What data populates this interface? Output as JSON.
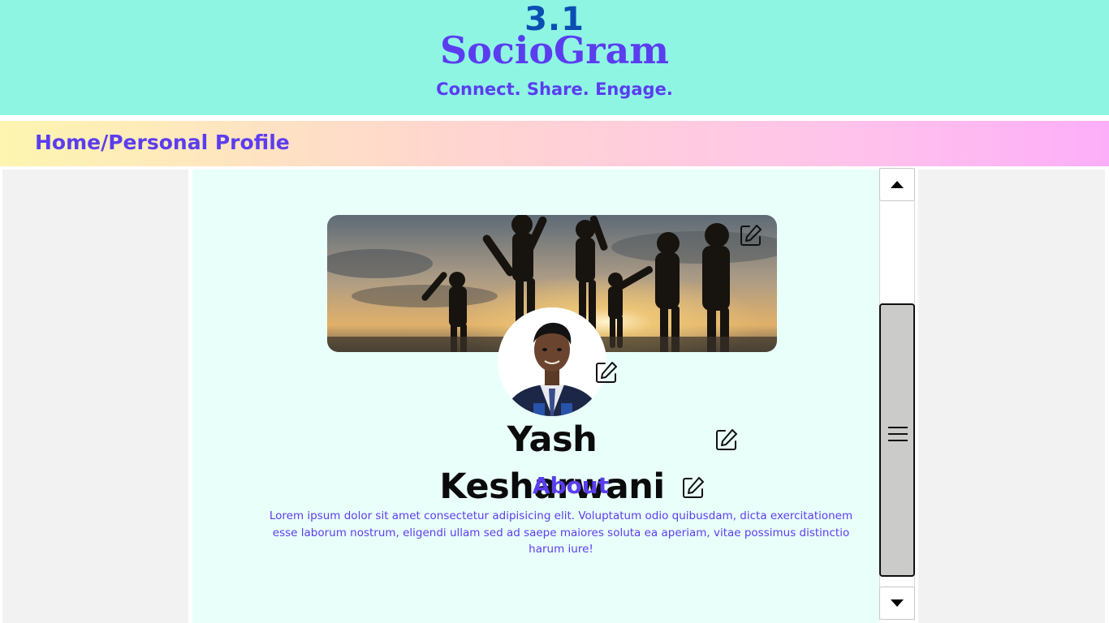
{
  "header": {
    "version": "3.1",
    "brand": "SocioGram",
    "tagline": "Connect. Share. Engage."
  },
  "breadcrumb": "Home/Personal Profile",
  "profile": {
    "name": "Yash Kesharwani",
    "about_title": "About",
    "about_text": "Lorem ipsum dolor sit amet consectetur adipisicing elit. Voluptatum odio quibusdam, dicta exercitationem esse laborum nostrum, eligendi ullam sed ad saepe maiores soluta ea aperiam, vitae possimus distinctio harum iure!"
  },
  "icons": {
    "edit": "edit-icon",
    "scroll_up": "arrow-up-icon",
    "scroll_down": "arrow-down-icon",
    "grip": "menu-grip-icon"
  },
  "colors": {
    "header_bg": "#8ef5e3",
    "accent": "#5b3df0",
    "version": "#0b4fb3",
    "main_bg": "#e9fffa",
    "side_bg": "#f2f2f2",
    "scroll_thumb": "#cbcbc9"
  }
}
